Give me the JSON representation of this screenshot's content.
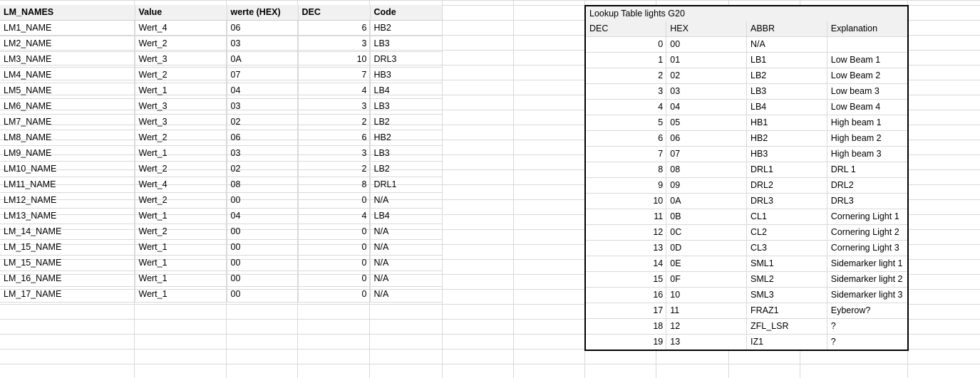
{
  "left_table": {
    "headers": [
      "LM_NAMES",
      "Value",
      "werte (HEX)",
      "DEC",
      "Code"
    ],
    "rows": [
      {
        "name": "LM1_NAME",
        "value": "Wert_4",
        "hex": "06",
        "dec": "6",
        "code": "HB2"
      },
      {
        "name": "LM2_NAME",
        "value": "Wert_2",
        "hex": "03",
        "dec": "3",
        "code": "LB3"
      },
      {
        "name": "LM3_NAME",
        "value": "Wert_3",
        "hex": "0A",
        "dec": "10",
        "code": "DRL3"
      },
      {
        "name": "LM4_NAME",
        "value": "Wert_2",
        "hex": "07",
        "dec": "7",
        "code": "HB3"
      },
      {
        "name": "LM5_NAME",
        "value": "Wert_1",
        "hex": "04",
        "dec": "4",
        "code": "LB4"
      },
      {
        "name": "LM6_NAME",
        "value": "Wert_3",
        "hex": "03",
        "dec": "3",
        "code": "LB3"
      },
      {
        "name": "LM7_NAME",
        "value": "Wert_3",
        "hex": "02",
        "dec": "2",
        "code": "LB2"
      },
      {
        "name": "LM8_NAME",
        "value": "Wert_2",
        "hex": "06",
        "dec": "6",
        "code": "HB2"
      },
      {
        "name": "LM9_NAME",
        "value": "Wert_1",
        "hex": "03",
        "dec": "3",
        "code": "LB3"
      },
      {
        "name": "LM10_NAME",
        "value": "Wert_2",
        "hex": "02",
        "dec": "2",
        "code": "LB2"
      },
      {
        "name": "LM11_NAME",
        "value": "Wert_4",
        "hex": "08",
        "dec": "8",
        "code": "DRL1"
      },
      {
        "name": "LM12_NAME",
        "value": "Wert_2",
        "hex": "00",
        "dec": "0",
        "code": "N/A"
      },
      {
        "name": "LM13_NAME",
        "value": "Wert_1",
        "hex": "04",
        "dec": "4",
        "code": "LB4"
      },
      {
        "name": "LM_14_NAME",
        "value": "Wert_2",
        "hex": "00",
        "dec": "0",
        "code": "N/A"
      },
      {
        "name": "LM_15_NAME",
        "value": "Wert_1",
        "hex": "00",
        "dec": "0",
        "code": "N/A"
      },
      {
        "name": "LM_15_NAME",
        "value": "Wert_1",
        "hex": "00",
        "dec": "0",
        "code": "N/A"
      },
      {
        "name": "LM_16_NAME",
        "value": "Wert_1",
        "hex": "00",
        "dec": "0",
        "code": "N/A"
      },
      {
        "name": "LM_17_NAME",
        "value": "Wert_1",
        "hex": "00",
        "dec": "0",
        "code": "N/A"
      }
    ]
  },
  "lookup_table": {
    "title": "Lookup Table lights G20",
    "headers": [
      "DEC",
      "HEX",
      "ABBR",
      "Explanation"
    ],
    "rows": [
      {
        "dec": "0",
        "hex": "00",
        "abbr": "N/A",
        "explanation": ""
      },
      {
        "dec": "1",
        "hex": "01",
        "abbr": "LB1",
        "explanation": "Low Beam 1"
      },
      {
        "dec": "2",
        "hex": "02",
        "abbr": "LB2",
        "explanation": "Low Beam 2"
      },
      {
        "dec": "3",
        "hex": "03",
        "abbr": "LB3",
        "explanation": "Low beam 3"
      },
      {
        "dec": "4",
        "hex": "04",
        "abbr": "LB4",
        "explanation": "Low Beam 4"
      },
      {
        "dec": "5",
        "hex": "05",
        "abbr": "HB1",
        "explanation": "High beam 1"
      },
      {
        "dec": "6",
        "hex": "06",
        "abbr": "HB2",
        "explanation": "High beam 2"
      },
      {
        "dec": "7",
        "hex": "07",
        "abbr": "HB3",
        "explanation": "High beam 3"
      },
      {
        "dec": "8",
        "hex": "08",
        "abbr": "DRL1",
        "explanation": "DRL 1"
      },
      {
        "dec": "9",
        "hex": "09",
        "abbr": "DRL2",
        "explanation": "DRL2"
      },
      {
        "dec": "10",
        "hex": "0A",
        "abbr": "DRL3",
        "explanation": "DRL3"
      },
      {
        "dec": "11",
        "hex": "0B",
        "abbr": "CL1",
        "explanation": "Cornering Light 1"
      },
      {
        "dec": "12",
        "hex": "0C",
        "abbr": "CL2",
        "explanation": "Cornering Light 2"
      },
      {
        "dec": "13",
        "hex": "0D",
        "abbr": "CL3",
        "explanation": "Cornering Light 3"
      },
      {
        "dec": "14",
        "hex": "0E",
        "abbr": "SML1",
        "explanation": "Sidemarker light 1"
      },
      {
        "dec": "15",
        "hex": "0F",
        "abbr": "SML2",
        "explanation": "Sidemarker light 2"
      },
      {
        "dec": "16",
        "hex": "10",
        "abbr": "SML3",
        "explanation": "Sidemarker light 3"
      },
      {
        "dec": "17",
        "hex": "11",
        "abbr": "FRAZ1",
        "explanation": "Eyberow?"
      },
      {
        "dec": "18",
        "hex": "12",
        "abbr": "ZFL_LSR",
        "explanation": "?"
      },
      {
        "dec": "19",
        "hex": "13",
        "abbr": "IZ1",
        "explanation": "?"
      }
    ]
  },
  "colors": {
    "header_fill": "#f1f1f1",
    "gridline": "#d9d9d9",
    "table_border": "#000000",
    "text": "#000000"
  }
}
